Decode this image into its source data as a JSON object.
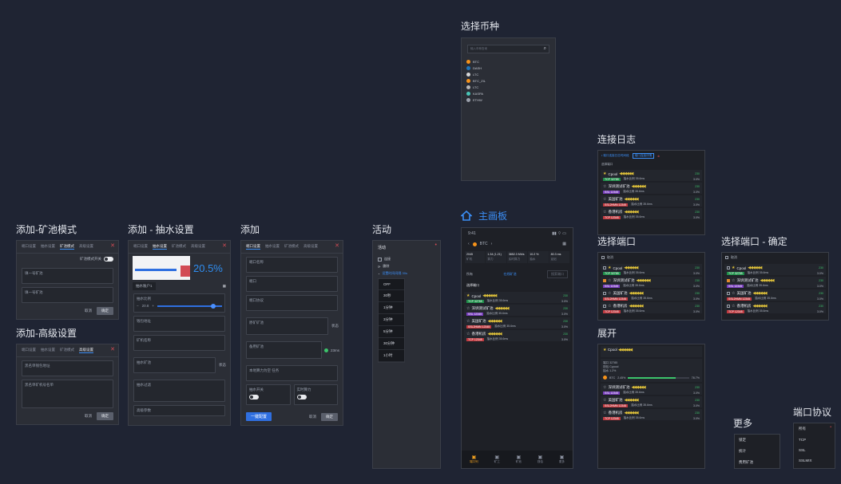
{
  "labels": {
    "add_pool_mode": "添加-矿池模式",
    "add_fee": "添加 - 抽水设置",
    "add": "添加",
    "activity": "活动",
    "add_advanced": "添加-高级设置",
    "select_coin": "选择币种",
    "dashboard": "主画板",
    "connection_log": "连接日志",
    "select_port": "选择端口",
    "select_port_confirm": "选择端口 - 确定",
    "expand": "展开",
    "more": "更多",
    "port_protocol": "端口协议"
  },
  "colors": {
    "bg": "#1f2433",
    "frame": "#2b2e36",
    "accent": "#3b8ef5",
    "danger": "#d24b55",
    "percent": "#2f8df0"
  },
  "form_tabs": [
    "端口设置",
    "抽水设置",
    "矿池模式",
    "高级设置"
  ],
  "pool_mode": {
    "toggle_label": "矿池模式开关",
    "field1": "填一号矿池",
    "field2": "填一号矿池",
    "cancel": "取消",
    "confirm": "确定"
  },
  "advanced": {
    "field1": "黑名单钱包地址",
    "field2": "黑名单矿机号名单",
    "cancel": "取消",
    "confirm": "确定"
  },
  "fee": {
    "percent": "20.5%",
    "account_tab": "抽水账户1",
    "ratio_label": "抽水比例",
    "ratio_value": "20.8",
    "wallet_label": "钱包地址",
    "miner_label": "矿机名称",
    "pool_label": "抽水矿池",
    "pool_filter_label": "抽水过滤",
    "advanced_label": "高级参数",
    "status_label": "状态"
  },
  "add_port": {
    "port_name": "端口名称",
    "port": "端口",
    "protocol": "端口协议",
    "pool": "原矿矿池",
    "backup_pool": "备用矿池",
    "ms": "23ms",
    "hashrate": "本地算力为空 任务",
    "switch1": "抽水开关",
    "switch2": "实时算力",
    "primary": "一键配置",
    "cancel": "取消",
    "confirm": "确定",
    "status_label": "状态"
  },
  "activity": {
    "title": "活动",
    "items": [
      "连接",
      "删除",
      "设置时间间隔 30s"
    ],
    "options": [
      "OFF",
      "30秒",
      "1分钟",
      "3分钟",
      "5分钟",
      "30分钟",
      "1小时"
    ]
  },
  "coins": {
    "search_placeholder": "输入币种查询",
    "list": [
      {
        "name": "BTC",
        "color": "#f7931a"
      },
      {
        "name": "DASH",
        "color": "#1c75bc"
      },
      {
        "name": "LTC",
        "color": "#d8d8d8"
      },
      {
        "name": "BTC_ZIL",
        "color": "#f7931a"
      },
      {
        "name": "LTC",
        "color": "#b7b7b7"
      },
      {
        "name": "KASPA",
        "color": "#49c5b6"
      },
      {
        "name": "ETHW",
        "color": "#9aa0ab"
      }
    ]
  },
  "dashboard": {
    "time": "9:41",
    "coin": "BTC",
    "stats": [
      {
        "v": "2045",
        "k": "矿机"
      },
      {
        "v": "1.34 (1.21)",
        "k": "算力"
      },
      {
        "v": "3852.3 Mh/s",
        "k": "实时算力"
      },
      {
        "v": "10.2 %",
        "k": "抽水"
      },
      {
        "v": "80.3 ms",
        "k": "延迟"
      }
    ],
    "filter": "所有",
    "sort": "在线矿池",
    "search": "搜索端口",
    "select_port": "选择端口",
    "nav": [
      "端口列",
      "矿工",
      "矿池",
      "钱包",
      "更多"
    ]
  },
  "pools": [
    {
      "name": "Cpool",
      "tag": "TCP 32785",
      "fee": "抽水比例 35.6ms",
      "pct": "3.0%",
      "num": "230",
      "tag_color": "#1f8f4a"
    },
    {
      "name": "深圳测试矿池",
      "tag": "SSL 12345",
      "fee": "抽水比例 35.6ms",
      "pct": "3.0%",
      "num": "230",
      "tag_color": "#7a3fbf"
    },
    {
      "name": "美国矿池",
      "tag": "SSL2HMN 12345",
      "fee": "抽水比例 35.6ms",
      "pct": "3.0%",
      "num": "230",
      "tag_color": "#c0393f"
    },
    {
      "name": "香港机房",
      "tag": "TCP 12345",
      "fee": "抽水比例 35.6ms",
      "pct": "3.0%",
      "num": "230",
      "tag_color": "#c0393f"
    }
  ],
  "log": {
    "link1": "• 端口连接日志时间段",
    "link2": "端口连接详情",
    "select_port": "选择端口"
  },
  "select": {
    "cancel": "取消"
  },
  "expand": {
    "title": "Cpool",
    "name": "BTC",
    "pct": "2.45%",
    "progress": 0.78,
    "detail_pct": "78.7%",
    "lines": [
      "端口 32785",
      "钱包 Cypool",
      "抽水 1.2%"
    ]
  },
  "more": {
    "items": [
      "锁定",
      "统计",
      "费用矿池"
    ]
  },
  "protocol": {
    "items": [
      "所有",
      "TCP",
      "SSL",
      "SSLMIX"
    ]
  }
}
